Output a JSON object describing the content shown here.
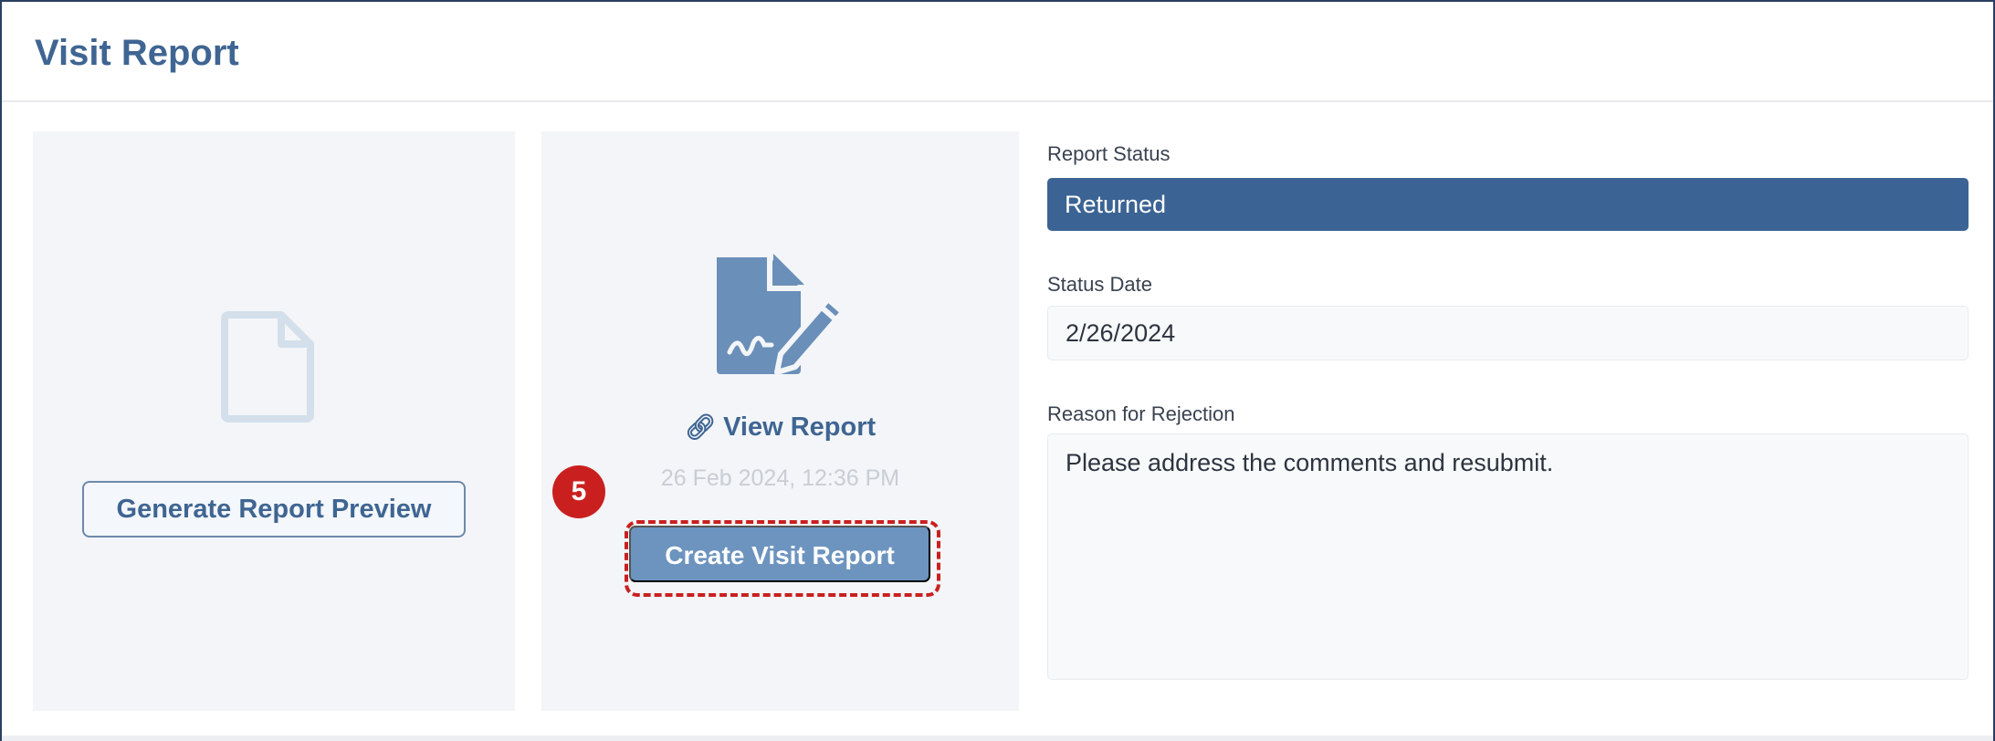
{
  "panel": {
    "title": "Visit Report"
  },
  "preview_card": {
    "icon": "file-outline-icon",
    "button_label": "Generate Report Preview"
  },
  "report_card": {
    "icon": "signed-document-icon",
    "link_icon": "link-icon",
    "link_label": "View Report",
    "timestamp": "26 Feb 2024, 12:36 PM",
    "button_label": "Create Visit Report"
  },
  "annotation": {
    "step_number": "5",
    "color": "#c9201f"
  },
  "form": {
    "status_label": "Report Status",
    "status_value": "Returned",
    "date_label": "Status Date",
    "date_value": "2/26/2024",
    "reason_label": "Reason for Rejection",
    "reason_value": "Please address the comments and resubmit."
  },
  "colors": {
    "accent": "#3f6592",
    "status_bg": "#3b6393",
    "button_primary": "#6d94bf",
    "icon_light": "#d3dfea",
    "icon_dark": "#6a8fb8"
  }
}
